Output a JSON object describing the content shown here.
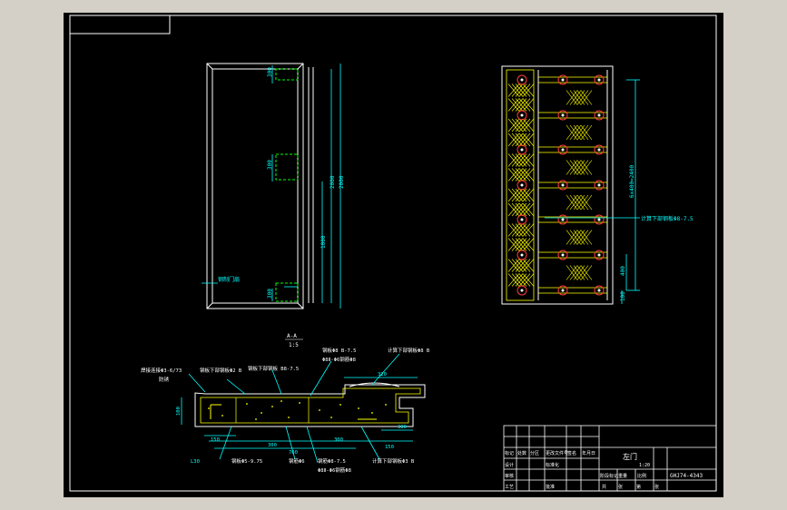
{
  "colors": {
    "chrome": "#d4d0c8",
    "paper": "#000000",
    "frame": "#ffffff",
    "door": "#ffffff",
    "dim": "#00ffff",
    "section": "#ffff00",
    "marker": "#ff3b3b"
  },
  "drawing": {
    "front_view": {
      "dims": [
        "300",
        "300",
        "300",
        "2000",
        "2000",
        "1000"
      ],
      "leader_label": "钢制门扇"
    },
    "side_view": {
      "dim_total": "6x400=2400",
      "dim_bottom": "400",
      "dim_small": "100",
      "note": "计算下部钢板Φ8-7.5"
    },
    "section_view": {
      "title": "A-A",
      "scale": "1:5",
      "notes": [
        "焊接连接Φ3-6/73",
        "防锈",
        "钢板下部钢板Φ2 B",
        "钢板下部钢板 B8-7.5",
        "钢板Φ8 B-7.5",
        "Φ8Ⅱ-Φ6钢筋Φ8",
        "计算下部钢板Φ8 B",
        "钢板Φ5-9.75",
        "钢筋Φ6",
        "钢筋Φ8-7.5",
        "Φ8Ⅱ-Φ6钢筋Φ8",
        "计算下部钢板Φ3 B"
      ],
      "dims": [
        "300",
        "100",
        "320",
        "150",
        "700",
        "300",
        "300",
        "150",
        "L30"
      ]
    },
    "title_block": {
      "drawing_name": "左门",
      "drawing_no": "GHJ74-4343",
      "scale": "1:20",
      "cells": [
        "标记",
        "处数",
        "分区",
        "更改文件号",
        "签名",
        "年月日",
        "设计",
        "标准化",
        "阶段标记",
        "重量",
        "比例",
        "审核",
        "工艺",
        "批准",
        "共",
        "张",
        "第",
        "张"
      ]
    }
  }
}
